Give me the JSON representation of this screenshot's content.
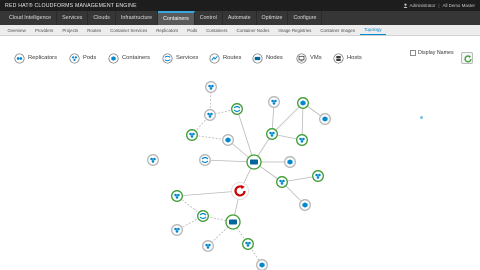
{
  "brand": {
    "text": "RED HAT® CLOUDFORMS MANAGEMENT ENGINE"
  },
  "user": {
    "name": "Administrator",
    "separator": "|",
    "region": "All Demo Master"
  },
  "primary_nav": [
    {
      "label": "Cloud Intelligence",
      "active": false
    },
    {
      "label": "Services",
      "active": false
    },
    {
      "label": "Clouds",
      "active": false
    },
    {
      "label": "Infrastructure",
      "active": false
    },
    {
      "label": "Containers",
      "active": true
    },
    {
      "label": "Control",
      "active": false
    },
    {
      "label": "Automate",
      "active": false
    },
    {
      "label": "Optimize",
      "active": false
    },
    {
      "label": "Configure",
      "active": false
    }
  ],
  "secondary_nav": [
    {
      "label": "Overview",
      "active": false
    },
    {
      "label": "Providers",
      "active": false
    },
    {
      "label": "Projects",
      "active": false
    },
    {
      "label": "Routes",
      "active": false
    },
    {
      "label": "Container Services",
      "active": false
    },
    {
      "label": "Replicators",
      "active": false
    },
    {
      "label": "Pods",
      "active": false
    },
    {
      "label": "Containers",
      "active": false
    },
    {
      "label": "Container Nodes",
      "active": false
    },
    {
      "label": "Image Registries",
      "active": false
    },
    {
      "label": "Container Images",
      "active": false
    },
    {
      "label": "Topology",
      "active": true
    }
  ],
  "kinds": [
    {
      "label": "Replicators",
      "icon": "replicator-icon"
    },
    {
      "label": "Pods",
      "icon": "pod-icon"
    },
    {
      "label": "Containers",
      "icon": "container-icon"
    },
    {
      "label": "Services",
      "icon": "service-icon"
    },
    {
      "label": "Routes",
      "icon": "route-icon"
    },
    {
      "label": "Nodes",
      "icon": "node-icon"
    },
    {
      "label": "VMs",
      "icon": "vm-icon"
    },
    {
      "label": "Hosts",
      "icon": "host-icon"
    }
  ],
  "display_names": {
    "label": "Display Names",
    "checked": false
  },
  "refresh": {
    "icon": "refresh-icon"
  },
  "colors": {
    "status_ok": "#3f9c35",
    "status_unknown": "#b7b7b7",
    "provider": "#cc0000",
    "entity_blue": "#0088ce",
    "node_teal": "#00659c"
  },
  "topology": {
    "center": {
      "kind": "provider",
      "status": "ok"
    },
    "nodes_summary": "2 container nodes with pods, services and containers"
  }
}
